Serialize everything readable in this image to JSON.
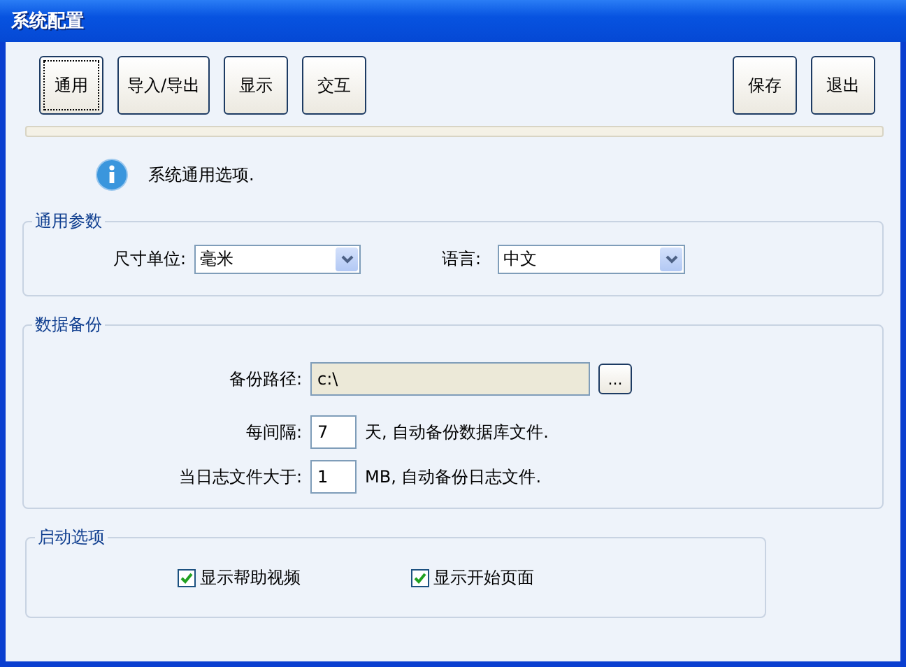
{
  "window": {
    "title": "系统配置"
  },
  "tabs": [
    {
      "label": "通用",
      "selected": true
    },
    {
      "label": "导入/导出",
      "selected": false
    },
    {
      "label": "显示",
      "selected": false
    },
    {
      "label": "交互",
      "selected": false
    }
  ],
  "actions": [
    "保存",
    "退出"
  ],
  "info": "系统通用选项.",
  "general": {
    "title": "通用参数",
    "unit_label": "尺寸单位:",
    "unit_value": "毫米",
    "language_label": "语言:",
    "language_value": "中文"
  },
  "backup": {
    "title": "数据备份",
    "path_label": "备份路径:",
    "path_value": "c:\\",
    "browse": "...",
    "interval_label": "每间隔:",
    "interval_value": "7",
    "interval_suffix": "天, 自动备份数据库文件.",
    "log_label": "当日志文件大于:",
    "log_value": "1",
    "log_suffix": "MB, 自动备份日志文件."
  },
  "startup": {
    "title": "启动选项",
    "options": [
      {
        "label": "显示帮助视频",
        "checked": true
      },
      {
        "label": "显示开始页面",
        "checked": true
      }
    ]
  }
}
